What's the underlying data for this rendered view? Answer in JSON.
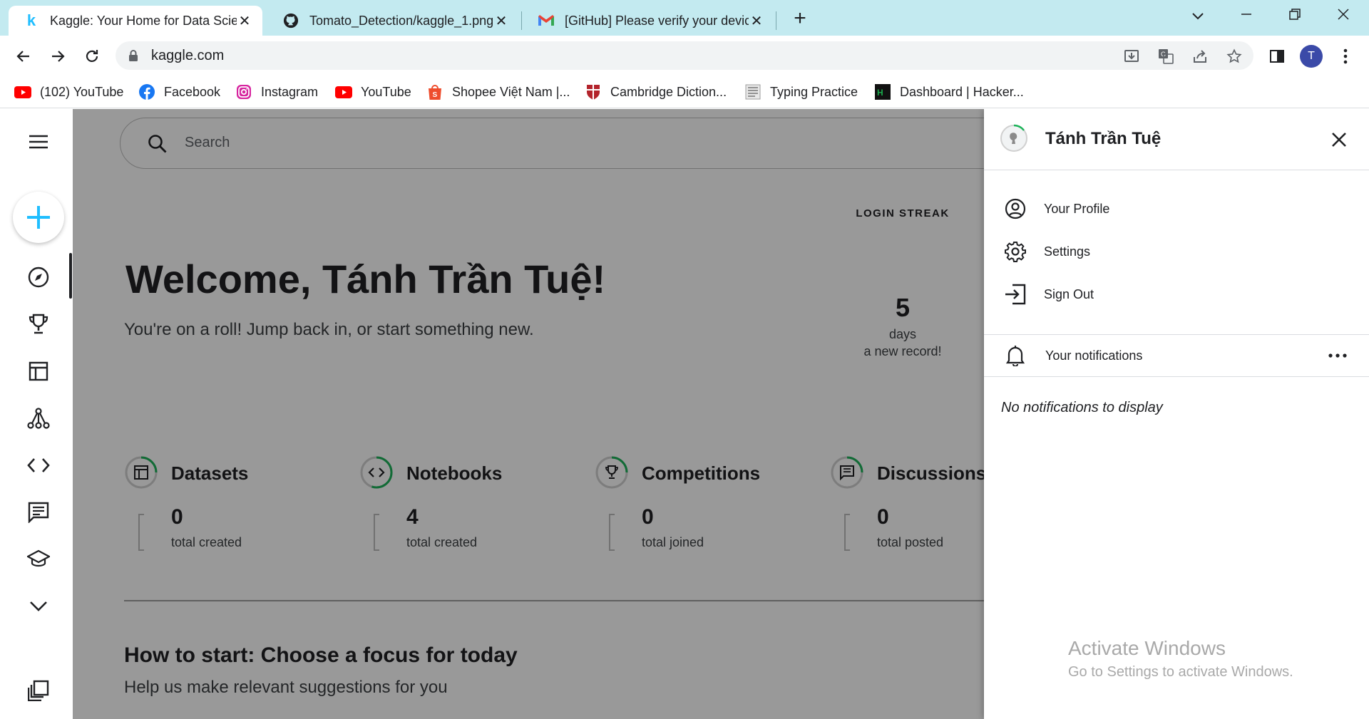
{
  "browser": {
    "tabs": [
      {
        "title": "Kaggle: Your Home for Data Scien",
        "favicon": "kaggle-k-icon",
        "active": true
      },
      {
        "title": "Tomato_Detection/kaggle_1.png",
        "favicon": "github-icon",
        "active": false
      },
      {
        "title": "[GitHub] Please verify your device",
        "favicon": "gmail-icon",
        "active": false
      }
    ],
    "url": "kaggle.com",
    "profile_initial": "T",
    "bookmarks": [
      {
        "label": "(102) YouTube",
        "icon": "youtube-icon"
      },
      {
        "label": "Facebook",
        "icon": "facebook-icon"
      },
      {
        "label": "Instagram",
        "icon": "instagram-icon"
      },
      {
        "label": "YouTube",
        "icon": "youtube-icon"
      },
      {
        "label": "Shopee Việt Nam |...",
        "icon": "shopee-icon"
      },
      {
        "label": "Cambridge Diction...",
        "icon": "cambridge-icon"
      },
      {
        "label": "Typing Practice",
        "icon": "typing-icon"
      },
      {
        "label": "Dashboard | Hacker...",
        "icon": "hackerrank-icon"
      }
    ]
  },
  "page": {
    "search_placeholder": "Search",
    "welcome_title": "Welcome, Tánh Trần Tuệ!",
    "welcome_subtitle": "You're on a roll! Jump back in, or start something new.",
    "streak": {
      "label": "LOGIN STREAK",
      "value": "5",
      "unit": "days",
      "note": "a new record!"
    },
    "stats": [
      {
        "name": "Datasets",
        "value": "0",
        "caption": "total created",
        "icon": "table-icon",
        "progress": 0.25
      },
      {
        "name": "Notebooks",
        "value": "4",
        "caption": "total created",
        "icon": "code-icon",
        "progress": 0.55
      },
      {
        "name": "Competitions",
        "value": "0",
        "caption": "total joined",
        "icon": "trophy-icon",
        "progress": 0.25
      },
      {
        "name": "Discussions",
        "value": "0",
        "caption": "total posted",
        "icon": "comment-icon",
        "progress": 0.25
      }
    ],
    "how_to_title": "How to start: Choose a focus for today",
    "how_to_subtitle": "Help us make relevant suggestions for you"
  },
  "drawer": {
    "user_name": "Tánh Trần Tuệ",
    "menu": [
      {
        "label": "Your Profile",
        "icon": "account-circle-icon"
      },
      {
        "label": "Settings",
        "icon": "gear-icon"
      },
      {
        "label": "Sign Out",
        "icon": "sign-out-icon"
      }
    ],
    "notifications_label": "Your notifications",
    "no_notifications": "No notifications to display"
  },
  "watermark": {
    "title": "Activate Windows",
    "subtitle": "Go to Settings to activate Windows."
  },
  "colors": {
    "accent_blue": "#20beff",
    "progress_green": "#1eb35a",
    "tabbar": "#c3eaf0"
  }
}
